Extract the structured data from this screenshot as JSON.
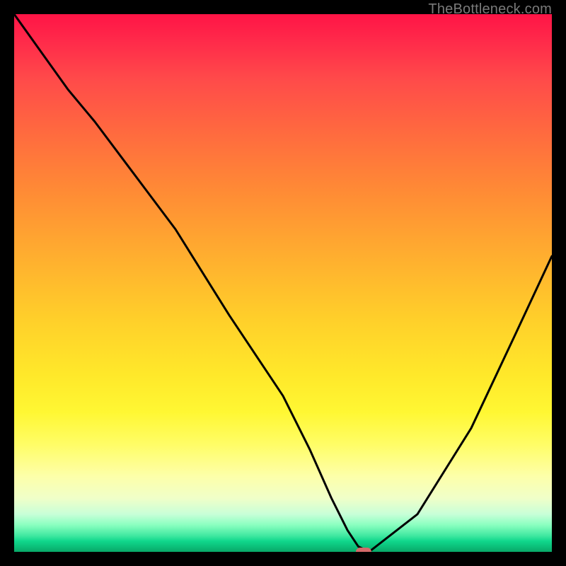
{
  "attribution": "TheBottleneck.com",
  "chart_data": {
    "type": "line",
    "title": "",
    "xlabel": "",
    "ylabel": "",
    "xlim": [
      0,
      100
    ],
    "ylim": [
      0,
      100
    ],
    "x": [
      0,
      5,
      10,
      15,
      21,
      30,
      40,
      50,
      55,
      59,
      62,
      64,
      66,
      75,
      85,
      93,
      100
    ],
    "values": [
      100,
      93,
      86,
      80,
      72,
      60,
      44,
      29,
      19,
      10,
      4,
      1,
      0,
      7,
      23,
      40,
      55
    ],
    "marker": {
      "x": 65,
      "y": 0
    },
    "grid": false
  },
  "colors": {
    "background": "#000000",
    "gradient_top": "#ff1446",
    "gradient_bottom": "#08a868",
    "curve": "#000000",
    "marker": "#d46a6a",
    "attribution": "#7a7a7a"
  }
}
